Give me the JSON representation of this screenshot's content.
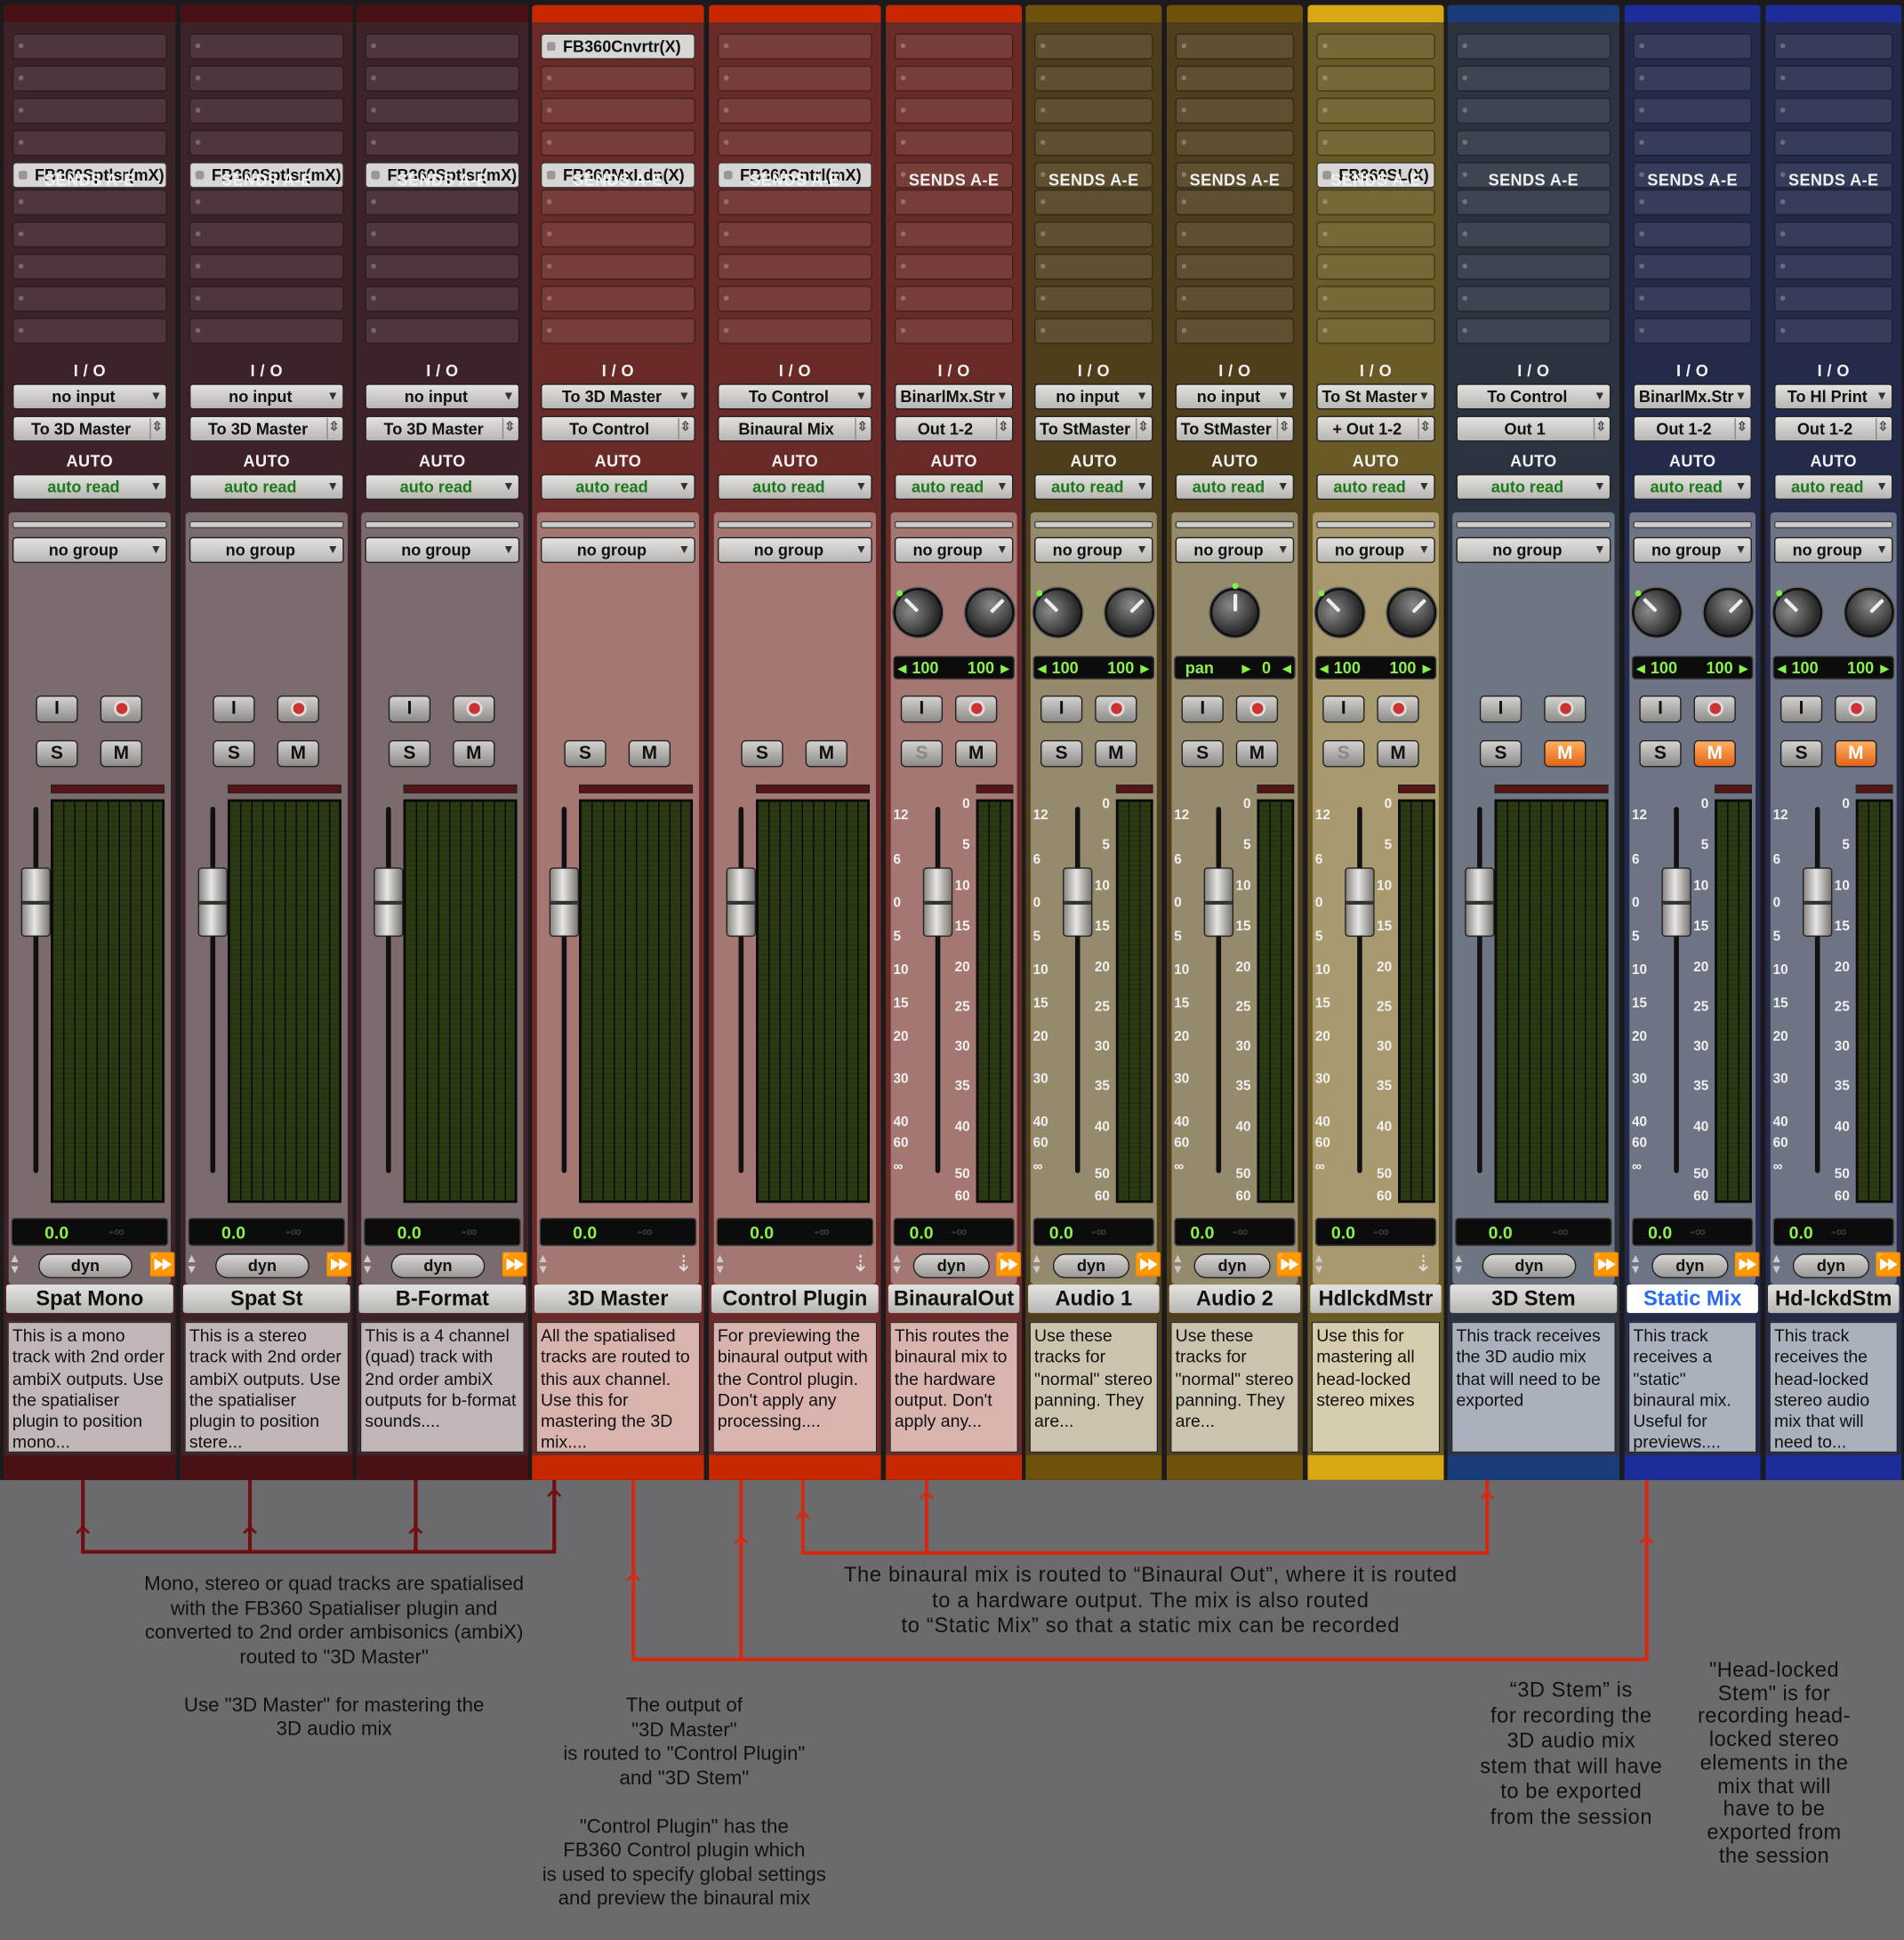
{
  "colors": {
    "background": "#6b6a6d",
    "accent_red": "#c82800",
    "wire_dark": "#6e0f12",
    "wire_red": "#d52a12"
  },
  "labels": {
    "sends": "SENDS A-E",
    "io": "I / O",
    "auto": "AUTO",
    "auto_mode": "auto read",
    "group": "no group",
    "dyn": "dyn",
    "volume": "0.0",
    "peak": "-∞"
  },
  "fader_scale": {
    "left": [
      "12",
      "6",
      "0",
      "5",
      "10",
      "15",
      "20",
      "30",
      "40",
      "60",
      "∞"
    ],
    "right": [
      "0",
      "5",
      "10",
      "15",
      "20",
      "25",
      "30",
      "35",
      "40",
      "50",
      "60"
    ]
  },
  "tracks": [
    {
      "name": "Spat Mono",
      "insert": "FB360Sptlsr(mX)",
      "input": "no input",
      "output": "To 3D Master",
      "comment": "This is a mono track with 2nd order ambiX outputs. Use the spatialiser plugin to position mono...",
      "mute_active": false
    },
    {
      "name": "Spat St",
      "insert": "FB360Sptlsr(mX)",
      "input": "no input",
      "output": "To 3D Master",
      "comment": "This is a stereo track with 2nd order ambiX outputs. Use the spatialiser plugin to position stere...",
      "mute_active": false
    },
    {
      "name": "B-Format",
      "insert": "FB360Sptlsr(mX)",
      "input": "no input",
      "output": "To 3D Master",
      "comment": "This is a 4 channel (quad) track with 2nd order ambiX outputs for b-format sounds....",
      "mute_active": false
    },
    {
      "name": "3D Master",
      "insert_top": "FB360Cnvrtr(X)",
      "insert": "FB360MxLdn(X)",
      "input": "To 3D Master",
      "output": "To Control",
      "comment": "All the spatialised tracks are routed to this aux channel. Use this for mastering the 3D mix....",
      "mute_active": false
    },
    {
      "name": "Control Plugin",
      "insert": "FB360Cntrl(mX)",
      "input": "To Control",
      "output": "Binaural Mix",
      "comment": "For previewing the binaural output with the Control plugin. Don't apply any processing....",
      "mute_active": false
    },
    {
      "name": "BinauralOut",
      "input": "BinarlMx.Str",
      "output": "Out 1-2",
      "pan": [
        "100",
        "100"
      ],
      "comment": "This routes the binaural mix to the hardware output. Don't apply any...",
      "mute_active": false
    },
    {
      "name": "Audio 1",
      "input": "no input",
      "output": "To StMaster",
      "pan": [
        "100",
        "100"
      ],
      "comment": "Use these tracks for \"normal\" stereo panning. They are...",
      "mute_active": false
    },
    {
      "name": "Audio 2",
      "input": "no input",
      "output": "To StMaster",
      "pan_label": "pan",
      "pan_value": "0",
      "comment": "Use these tracks for \"normal\" stereo panning. They are...",
      "mute_active": false
    },
    {
      "name": "HdlckdMstr",
      "insert": "FB360SL(X)",
      "input": "To St Master",
      "output": "+ Out 1-2",
      "pan": [
        "100",
        "100"
      ],
      "comment": "Use this for mastering all head-locked stereo mixes",
      "mute_active": false
    },
    {
      "name": "3D Stem",
      "input": "To Control",
      "output": "Out 1",
      "comment": "This track receives the 3D audio mix that will need to be exported",
      "mute_active": true
    },
    {
      "name": "Static Mix",
      "input": "BinarlMx.Str",
      "output": "Out 1-2",
      "pan": [
        "100",
        "100"
      ],
      "comment": "This track receives a \"static\" binaural mix. Useful for previews....",
      "mute_active": true
    },
    {
      "name": "Hd-lckdStm",
      "input": "To Hl Print",
      "output": "Out 1-2",
      "pan": [
        "100",
        "100"
      ],
      "comment": "This track receives the head-locked stereo audio mix that will need to...",
      "mute_active": true
    }
  ],
  "annotations": {
    "spatialised": "Mono, stereo or quad tracks are spatialised\nwith the FB360 Spatialiser plugin and\nconverted to 2nd order ambisonics (ambiX)\nrouted to \"3D Master\"\n\nUse \"3D Master\" for mastering the\n3D audio mix",
    "output_3d": "The output of\n\"3D Master\"\nis routed to \"Control Plugin\"\nand \"3D Stem\"\n\n\"Control Plugin\" has the\nFB360 Control plugin which\nis used to specify global settings\nand preview the binaural mix",
    "binaural": "The binaural mix is routed to “Binaural Out”, where it is routed\nto a hardware output. The mix is also routed\nto “Static Mix” so that a static mix can be recorded",
    "stem3d": "“3D Stem” is\nfor recording the\n3D audio mix\nstem that will have\nto be exported\nfrom the session",
    "headlocked": "\"Head-locked\nStem\" is for\nrecording head-\nlocked stereo\nelements in the\nmix that will\nhave to be\nexported from\nthe session"
  }
}
